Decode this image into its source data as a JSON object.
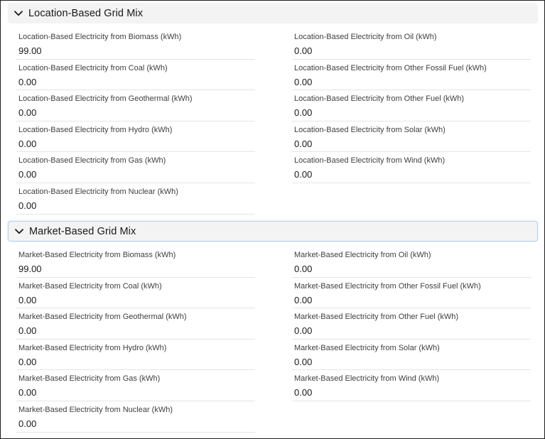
{
  "sections": [
    {
      "title": "Location-Based Grid Mix",
      "left": [
        {
          "label": "Location-Based Electricity from Biomass (kWh)",
          "value": "99.00"
        },
        {
          "label": "Location-Based Electricity from Coal (kWh)",
          "value": "0.00"
        },
        {
          "label": "Location-Based Electricity from Geothermal (kWh)",
          "value": "0.00"
        },
        {
          "label": "Location-Based Electricity from Hydro (kWh)",
          "value": "0.00"
        },
        {
          "label": "Location-Based Electricity from Gas (kWh)",
          "value": "0.00"
        },
        {
          "label": "Location-Based Electricity from Nuclear (kWh)",
          "value": "0.00"
        }
      ],
      "right": [
        {
          "label": "Location-Based Electricity from Oil (kWh)",
          "value": "0.00"
        },
        {
          "label": "Location-Based Electricity from Other Fossil Fuel (kWh)",
          "value": "0.00"
        },
        {
          "label": "Location-Based Electricity from Other Fuel (kWh)",
          "value": "0.00"
        },
        {
          "label": "Location-Based Electricity from Solar (kWh)",
          "value": "0.00"
        },
        {
          "label": "Location-Based Electricity from Wind (kWh)",
          "value": "0.00"
        }
      ]
    },
    {
      "title": "Market-Based Grid Mix",
      "left": [
        {
          "label": "Market-Based Electricity from Biomass (kWh)",
          "value": "99.00"
        },
        {
          "label": "Market-Based Electricity from Coal (kWh)",
          "value": "0.00"
        },
        {
          "label": "Market-Based Electricity from Geothermal (kWh)",
          "value": "0.00"
        },
        {
          "label": "Market-Based Electricity from Hydro (kWh)",
          "value": "0.00"
        },
        {
          "label": "Market-Based Electricity from Gas (kWh)",
          "value": "0.00"
        },
        {
          "label": "Market-Based Electricity from Nuclear (kWh)",
          "value": "0.00"
        }
      ],
      "right": [
        {
          "label": "Market-Based Electricity from Oil (kWh)",
          "value": "0.00"
        },
        {
          "label": "Market-Based Electricity from Other Fossil Fuel (kWh)",
          "value": "0.00"
        },
        {
          "label": "Market-Based Electricity from Other Fuel (kWh)",
          "value": "0.00"
        },
        {
          "label": "Market-Based Electricity from Solar (kWh)",
          "value": "0.00"
        },
        {
          "label": "Market-Based Electricity from Wind (kWh)",
          "value": "0.00"
        }
      ]
    }
  ],
  "icons": {
    "section_toggle": "chevron-down-icon"
  }
}
